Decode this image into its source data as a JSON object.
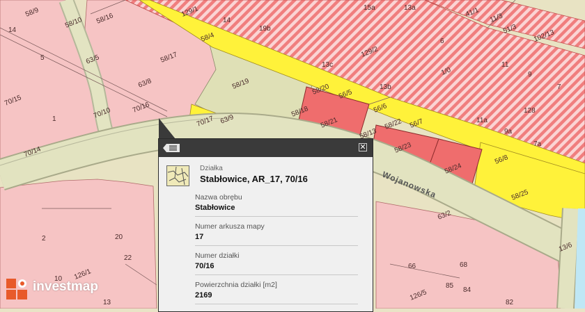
{
  "colors": {
    "background": "#e9e3c6",
    "residential": "#f6c4c4",
    "hatched": "#f08a8a",
    "highlight": "#ef6d6d",
    "road": "#fff23a",
    "green": "#dfe1b8",
    "popup_header": "#3a3a3a",
    "logo_orange": "#e85a2a"
  },
  "map": {
    "street_label": "Wojanowska",
    "parcel_labels": [
      "58/9",
      "58/10",
      "58/16",
      "14",
      "129/1",
      "14",
      "19b",
      "15a",
      "13a",
      "41/1",
      "11/3",
      "51/3",
      "102/13",
      "5",
      "63/5",
      "58/4",
      "58/17",
      "129/2",
      "13c",
      "13b",
      "6",
      "11",
      "9",
      "7",
      "1/0",
      "70/15",
      "1",
      "63/8",
      "70/10",
      "70/16",
      "58/19",
      "58/20",
      "56/5",
      "58/18",
      "58/21",
      "56/6",
      "128",
      "11a",
      "56/7",
      "9a",
      "7a",
      "70/17",
      "63/9",
      "58/13",
      "58/22",
      "58/23",
      "58/24",
      "56/8",
      "70/14",
      "58/25",
      "63/2",
      "13/6",
      "20",
      "22",
      "10",
      "126/1",
      "2",
      "13",
      "66",
      "68",
      "85",
      "84",
      "126/5",
      "82"
    ]
  },
  "popup": {
    "object_type": "Działka",
    "title": "Stabłowice, AR_17, 70/16",
    "fields": [
      {
        "label": "Nazwa obrębu",
        "value": "Stabłowice"
      },
      {
        "label": "Numer arkusza mapy",
        "value": "17"
      },
      {
        "label": "Numer działki",
        "value": "70/16"
      },
      {
        "label": "Powierzchnia działki [m2]",
        "value": "2169"
      }
    ],
    "close_glyph": "✕"
  },
  "logo": {
    "text": "investmap"
  }
}
